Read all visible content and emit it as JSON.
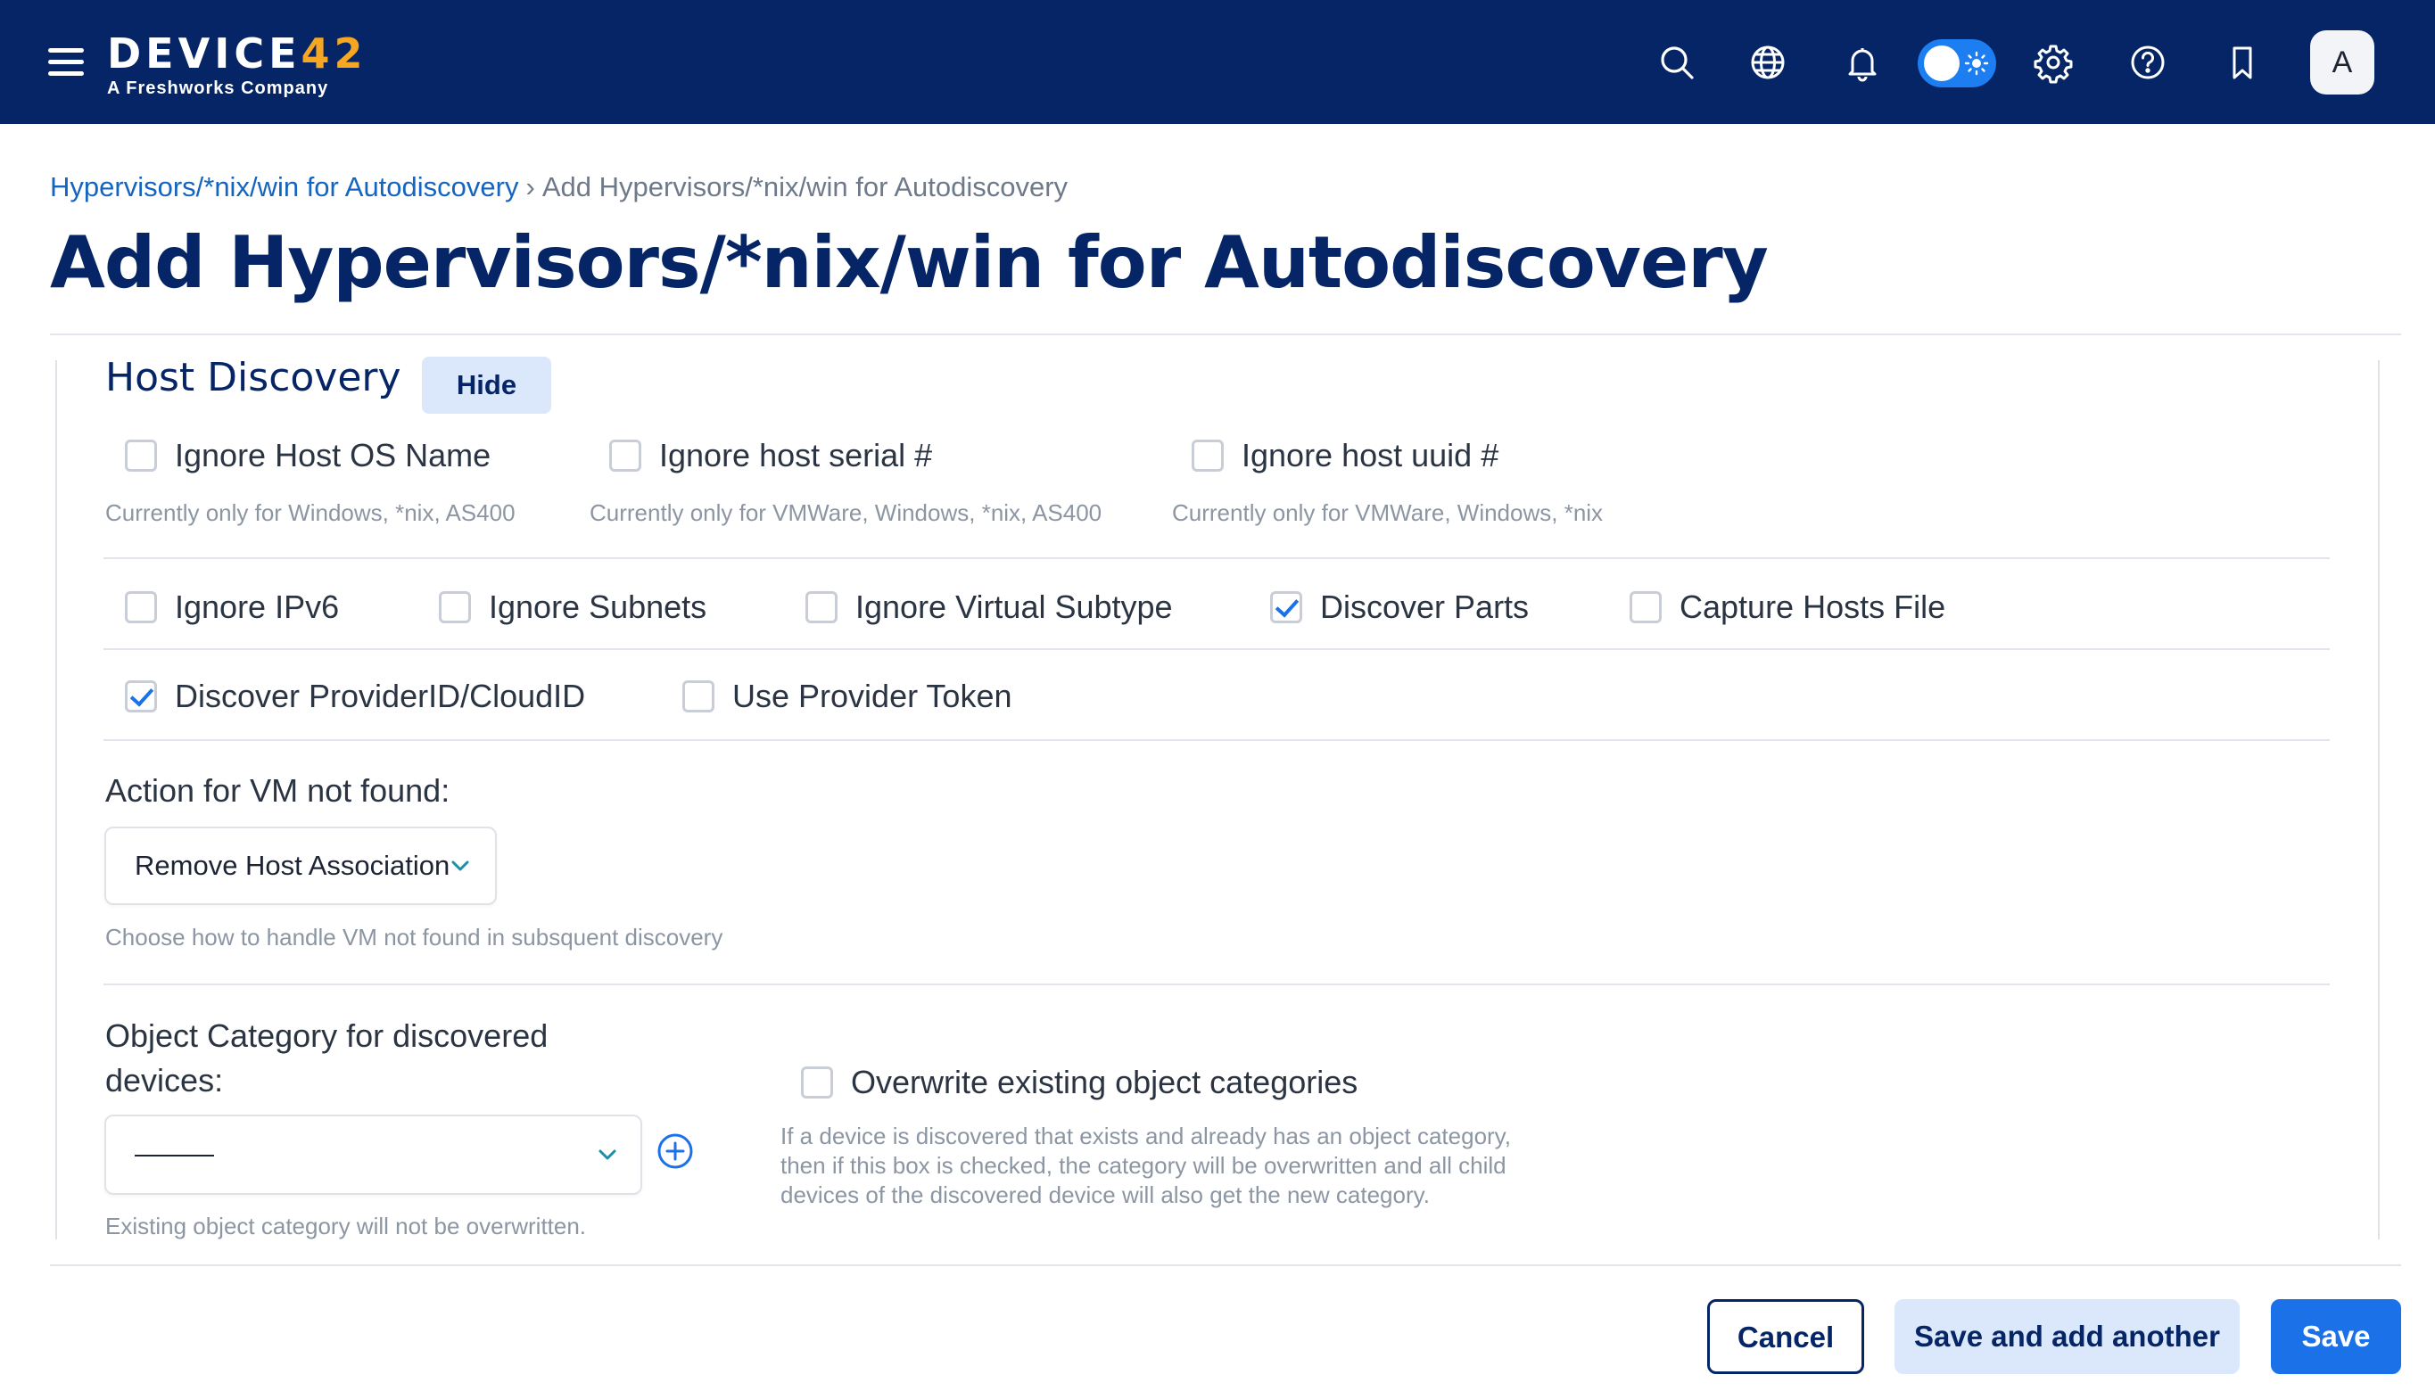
{
  "header": {
    "logo_main": "DEVICE",
    "logo_accent": "42",
    "logo_sub": "A Freshworks Company",
    "avatar_initial": "A"
  },
  "breadcrumb": {
    "parent": "Hypervisors/*nix/win for Autodiscovery",
    "separator": "›",
    "current": "Add Hypervisors/*nix/win for Autodiscovery"
  },
  "page": {
    "title": "Add Hypervisors/*nix/win for Autodiscovery"
  },
  "section": {
    "title": "Host Discovery",
    "hide_label": "Hide"
  },
  "host_options": [
    {
      "label": "Ignore Host OS Name",
      "checked": false,
      "hint": "Currently only for Windows, *nix, AS400"
    },
    {
      "label": "Ignore host serial #",
      "checked": false,
      "hint": "Currently only for VMWare, Windows, *nix, AS400"
    },
    {
      "label": "Ignore host uuid #",
      "checked": false,
      "hint": "Currently only for VMWare, Windows, *nix"
    }
  ],
  "options_row1": [
    {
      "label": "Ignore IPv6",
      "checked": false
    },
    {
      "label": "Ignore Subnets",
      "checked": false
    },
    {
      "label": "Ignore Virtual Subtype",
      "checked": false
    },
    {
      "label": "Discover Parts",
      "checked": true
    },
    {
      "label": "Capture Hosts File",
      "checked": false
    }
  ],
  "options_row2": [
    {
      "label": "Discover ProviderID/CloudID",
      "checked": true
    },
    {
      "label": "Use Provider Token",
      "checked": false
    }
  ],
  "vm_action": {
    "label": "Action for VM not found:",
    "selected": "Remove Host Association",
    "hint": "Choose how to handle VM not found in subsquent discovery"
  },
  "object_category": {
    "label_line1": "Object Category for discovered",
    "label_line2": "devices:",
    "selected": "———",
    "hint": "Existing object category will not be overwritten.",
    "overwrite_label": "Overwrite existing object categories",
    "overwrite_checked": false,
    "overwrite_hint": "If a device is discovered that exists and already has an object category, then if this box is checked, the category will be overwritten and all child devices of the discovered device will also get the new category."
  },
  "footer": {
    "cancel": "Cancel",
    "save_another": "Save and add another",
    "save": "Save"
  },
  "colors": {
    "topbar": "#052566",
    "accent": "#1b72e8",
    "logo_accent": "#f5a623"
  },
  "icons": [
    "menu-icon",
    "search-icon",
    "globe-icon",
    "bell-icon",
    "theme-toggle",
    "gear-icon",
    "help-icon",
    "bookmark-icon"
  ]
}
